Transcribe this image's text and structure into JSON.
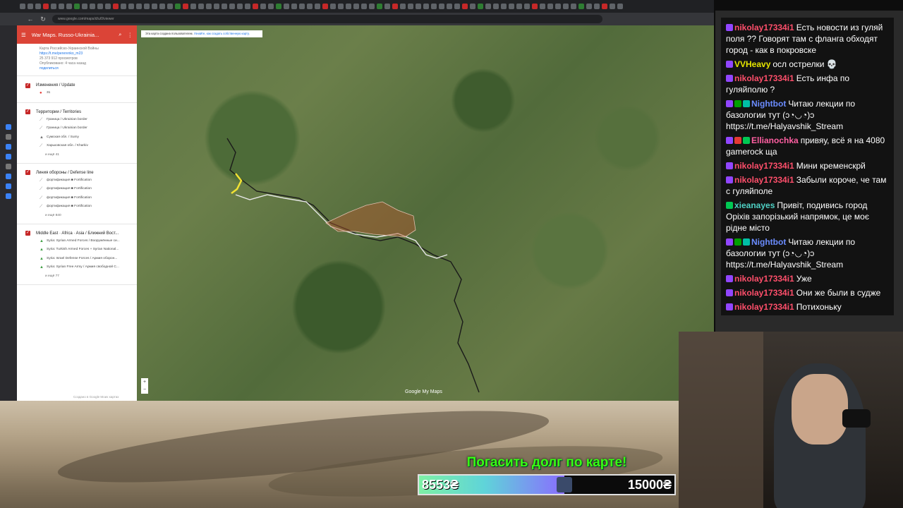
{
  "browser": {
    "url": "www.google.com/maps/d/u/0/viewer"
  },
  "sidepanel": {
    "title": "War Maps. Russo-Ukrainia...",
    "map_description": "Карта Российско-Украинской Войны",
    "link": "https://t.me/pererenko_m23",
    "views": "25 373 912 просмотров",
    "published": "Опубликовано: 4 часа назад",
    "share": "поделиться",
    "layers": [
      {
        "title": "Изменения / Update",
        "items": [
          {
            "label": "31",
            "icon": "dot-icon"
          }
        ],
        "more": ""
      },
      {
        "title": "Территории / Territories",
        "items": [
          {
            "label": "Граница / Ukrainian border",
            "icon": "line-icon"
          },
          {
            "label": "Граница / Ukrainian border",
            "icon": "line-icon"
          },
          {
            "label": "Сумская обл. / Sumy",
            "icon": "polygon-icon"
          },
          {
            "label": "Харьковская обл. / Kharkiv",
            "icon": "line-icon"
          }
        ],
        "more": "и ещё 41"
      },
      {
        "title": "Линия обороны / Defense line",
        "items": [
          {
            "label": "фортификация ■ Fortification",
            "icon": "line-icon"
          },
          {
            "label": "фортификация ■ Fortification",
            "icon": "line-icon"
          },
          {
            "label": "фортификация ■ Fortification",
            "icon": "line-icon"
          },
          {
            "label": "фортификация ■ Fortification",
            "icon": "line-icon"
          }
        ],
        "more": "и ещё 840"
      },
      {
        "title": "Middle East · Africa · Asia / Ближний Вост...",
        "items": [
          {
            "label": "Syria: Syrian Armed Forces / Вооружённые си...",
            "icon": "polygon-green-icon"
          },
          {
            "label": "Syria: Turkish Armed Forces + Syrian National...",
            "icon": "polygon-green-icon"
          },
          {
            "label": "Syria: Israel Defense Forces / Армия оборон...",
            "icon": "polygon-green-icon"
          },
          {
            "label": "Syria: Syrian Free Army / Армия свободной С...",
            "icon": "polygon-green-icon"
          }
        ],
        "more": "и ещё 77"
      }
    ]
  },
  "map": {
    "notice_text": "Эта карта создана пользователем.",
    "notice_link": "Узнайте, как создать собственную карту.",
    "logo": "Google My Maps",
    "credit": "Создано в Google Моих картах",
    "zoom_in": "+",
    "zoom_out": "−"
  },
  "chat": {
    "messages": [
      {
        "user": "nikolay17334i1",
        "color": "red",
        "badges": [
          "purple"
        ],
        "text": "Есть новости из гуляй поля ?? Говорят там с фланга обходят город - как в покровске"
      },
      {
        "user": "VVHeavy",
        "color": "yellow",
        "badges": [
          "purple"
        ],
        "text": "осл острелки 💀"
      },
      {
        "user": "nikolay17334i1",
        "color": "red",
        "badges": [
          "purple"
        ],
        "text": "Есть инфа по гуляйполю ?"
      },
      {
        "user": "Nightbot",
        "color": "blue",
        "badges": [
          "purple",
          "check",
          "teal"
        ],
        "text": "Читаю лекции по базологии тут (ↄ◔◡◔)ↄ https://t.me/Halyavshik_Stream"
      },
      {
        "user": "Ellianochka",
        "color": "pink",
        "badges": [
          "purple",
          "red",
          "green"
        ],
        "text": "привяу, всё я на 4080 gamerock ща"
      },
      {
        "user": "nikolay17334i1",
        "color": "red",
        "badges": [
          "purple"
        ],
        "text": "Мини кременскрй"
      },
      {
        "user": "nikolay17334i1",
        "color": "red",
        "badges": [
          "purple"
        ],
        "text": "Забыли короче, че там с гуляйполе"
      },
      {
        "user": "xieanayes",
        "color": "teal",
        "badges": [
          "green"
        ],
        "text": "Привіт, подивись город Оріхів запорізький напрямок, це моє рідне місто"
      },
      {
        "user": "Nightbot",
        "color": "blue",
        "badges": [
          "purple",
          "check",
          "teal"
        ],
        "text": "Читаю лекции по базологии тут (ↄ◔◡◔)ↄ https://t.me/Halyavshik_Stream"
      },
      {
        "user": "nikolay17334i1",
        "color": "red",
        "badges": [
          "purple"
        ],
        "text": "Уже"
      },
      {
        "user": "nikolay17334i1",
        "color": "red",
        "badges": [
          "purple"
        ],
        "text": "Они же были в судже"
      },
      {
        "user": "nikolay17334i1",
        "color": "red",
        "badges": [
          "purple"
        ],
        "text": "Потихоньку"
      }
    ]
  },
  "donation": {
    "title": "Погасить долг по карте!",
    "current": "8553₴",
    "goal": "15000₴",
    "progress": 0.57
  }
}
